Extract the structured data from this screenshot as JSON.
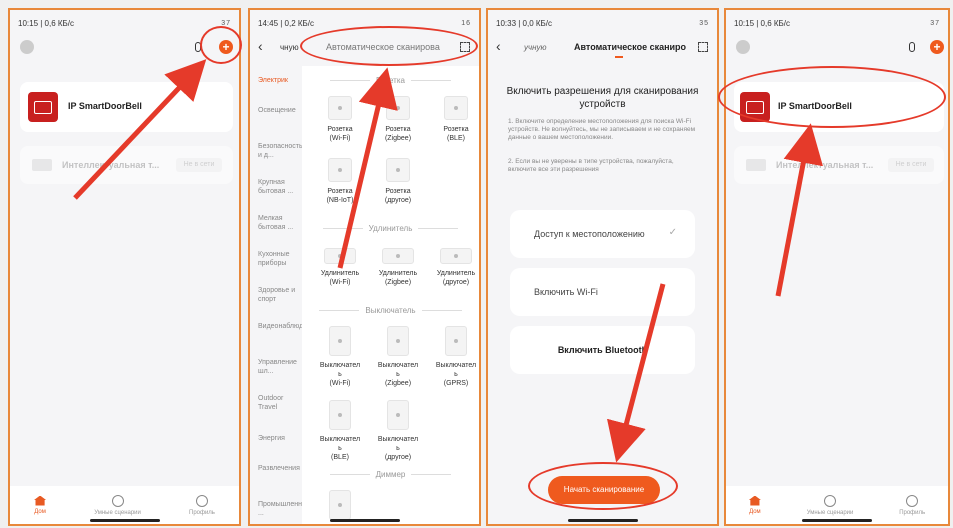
{
  "panel1": {
    "status_time": "10:15 | 0,6 КБ/с",
    "status_right": "37",
    "device_card": {
      "name": "IP SmartDoorBell"
    },
    "offline_card": {
      "name": "Интеллектуальная т...",
      "badge": "Не в сети"
    }
  },
  "panel2": {
    "status_time": "14:45 | 0,2 КБ/с",
    "status_right": "16",
    "back_fragment": "чную",
    "header_title": "Автоматическое сканирова",
    "sidebar": [
      "Электрик",
      "Освещение",
      "Безопасность и д...",
      "Крупная бытовая ...",
      "Мелкая бытовая ...",
      "Кухонные приборы",
      "Здоровье и спорт",
      "Видеонаблюдение",
      "Управление шл...",
      "Outdoor Travel",
      "Энергия",
      "Развлечения",
      "Промышленность ..."
    ],
    "sections": {
      "socket": "Розетка",
      "extender": "Удлинитель",
      "switch": "Выключатель",
      "dimmer": "Диммер"
    },
    "sockets": [
      {
        "l1": "Розетка",
        "l2": "(Wi-Fi)"
      },
      {
        "l1": "Розетка",
        "l2": "(Zigbee)"
      },
      {
        "l1": "Розетка",
        "l2": "(BLE)"
      },
      {
        "l1": "Розетка",
        "l2": "(NB-IoT)"
      },
      {
        "l1": "Розетка",
        "l2": "(другое)"
      }
    ],
    "extenders": [
      {
        "l1": "Удлинитель",
        "l2": "(Wi-Fi)"
      },
      {
        "l1": "Удлинитель",
        "l2": "(Zigbee)"
      },
      {
        "l1": "Удлинитель",
        "l2": "(другое)"
      }
    ],
    "switches": [
      {
        "l1": "Выключател",
        "l2": "ь",
        "l3": "(Wi-Fi)"
      },
      {
        "l1": "Выключател",
        "l2": "ь",
        "l3": "(Zigbee)"
      },
      {
        "l1": "Выключател",
        "l2": "ь",
        "l3": "(GPRS)"
      },
      {
        "l1": "Выключател",
        "l2": "ь",
        "l3": "(BLE)"
      },
      {
        "l1": "Выключател",
        "l2": "ь",
        "l3": "(другое)"
      }
    ]
  },
  "panel3": {
    "status_time": "10:33 | 0,0 КБ/с",
    "status_right": "35",
    "back_fragment": "учную",
    "header_title": "Автоматическое сканиро",
    "heading": "Включить разрешения для сканирования устройств",
    "info1": "1. Включите определение местоположения для поиска Wi-Fi устройств. Не волнуйтесь, мы не записываем и не сохраняем данные о вашем местоположении.",
    "info2": "2. Если вы не уверены в типе устройства, пожалуйста, включите все эти разрешения",
    "opt_location": "Доступ к местоположению",
    "opt_wifi": "Включить Wi-Fi",
    "opt_bt": "Включить Bluetooth",
    "start_button": "Начать сканирование"
  },
  "panel4": {
    "status_time": "10:15 | 0,6 КБ/с",
    "status_right": "37",
    "device_card": {
      "name": "IP SmartDoorBell"
    },
    "offline_card": {
      "name": "Интеллектуальная т...",
      "badge": "Не в сети"
    }
  },
  "nav": {
    "home": "Дом",
    "scenes": "Умные сценарии",
    "profile": "Профиль"
  },
  "colors": {
    "accent": "#ef5a1e",
    "annotation": "#e53a2a",
    "frame": "#e8883a"
  }
}
